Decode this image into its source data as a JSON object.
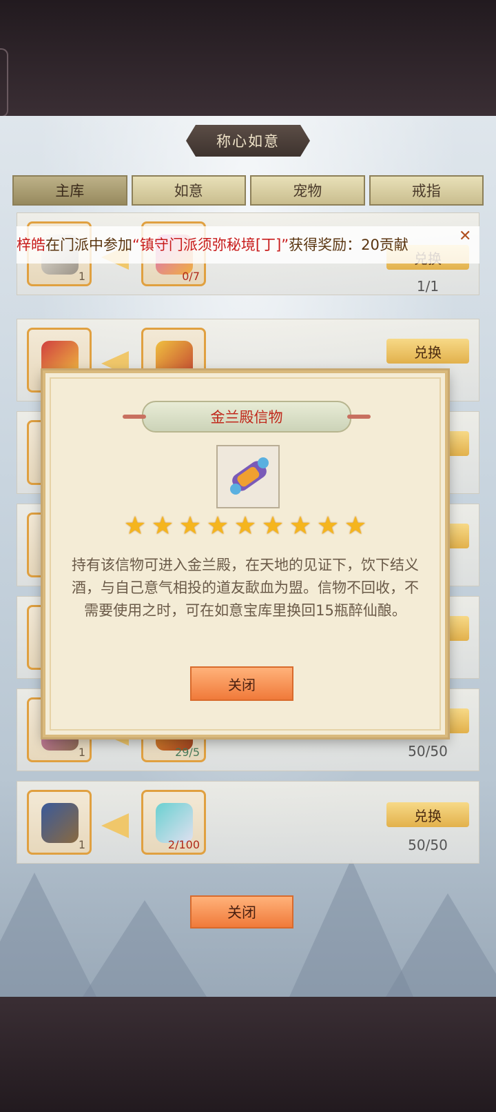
{
  "panel": {
    "title": "称心如意"
  },
  "tabs": [
    {
      "label": "主库"
    },
    {
      "label": "如意"
    },
    {
      "label": "宠物"
    },
    {
      "label": "戒指"
    }
  ],
  "ticker": {
    "name": "梓皓",
    "text_before": "在门派中参加",
    "highlight": "“镇守门派须弥秘境[丁]”",
    "text_after": "获得奖励：20贡献"
  },
  "rows": [
    {
      "give_qty": "1",
      "need_qty": "0/7",
      "button": "兑换",
      "count": "1/1"
    },
    {
      "give_qty": "",
      "need_qty": "",
      "button": "兑换",
      "count": ""
    },
    {
      "give_qty": "",
      "need_qty": "",
      "button": "",
      "count": ""
    },
    {
      "give_qty": "",
      "need_qty": "",
      "button": "",
      "count": ""
    },
    {
      "give_qty": "",
      "need_qty": "",
      "button": "",
      "count": ""
    },
    {
      "give_qty": "1",
      "need_qty": "29/5",
      "button": "兑换",
      "count": "50/50"
    },
    {
      "give_qty": "1",
      "need_qty": "2/100",
      "button": "兑换",
      "count": "50/50"
    }
  ],
  "modal": {
    "title": "金兰殿信物",
    "stars": 9,
    "description": "持有该信物可进入金兰殿，在天地的见证下，饮下结义酒，与自己意气相投的道友歃血为盟。信物不回收，不需要使用之时，可在如意宝库里换回15瓶醉仙酿。",
    "close_label": "关闭"
  },
  "close_label": "关闭",
  "colors": {
    "accent_gold": "#e2b14c",
    "button_orange": "#f07a3a",
    "highlight_red": "#c81c1c"
  }
}
